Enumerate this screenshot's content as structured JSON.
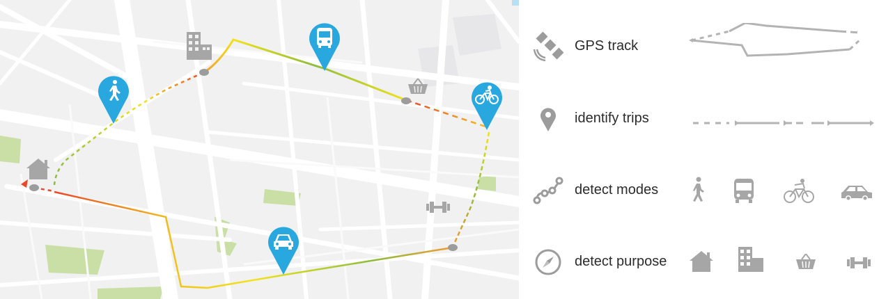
{
  "legend": {
    "items": [
      {
        "label": "GPS track",
        "icon": "satellite-icon"
      },
      {
        "label": "identify trips",
        "icon": "location-pin-icon"
      },
      {
        "label": "detect modes",
        "icon": "route-nodes-icon"
      },
      {
        "label": "detect purpose",
        "icon": "compass-icon"
      }
    ],
    "mode_icons": [
      "walking-icon",
      "bus-icon",
      "bicycle-icon",
      "car-icon"
    ],
    "purpose_icons": [
      "home-icon",
      "office-building-icon",
      "shopping-basket-icon",
      "dumbbell-icon"
    ]
  },
  "map": {
    "markers": [
      "walking-icon",
      "bus-icon",
      "bicycle-icon",
      "car-icon"
    ],
    "places": [
      "home-icon",
      "office-building-icon",
      "shopping-basket-icon",
      "dumbbell-icon"
    ]
  },
  "colors": {
    "marker_blue": "#29a8e0",
    "icon_gray": "#9c9c9c",
    "track_red": "#e8472b",
    "track_orange": "#f29a2e",
    "track_yellow": "#f2e21c",
    "track_green": "#8dbd3e",
    "park_green": "#c9dfa6",
    "road": "#ffffff",
    "map_background": "#f1f1f2"
  }
}
